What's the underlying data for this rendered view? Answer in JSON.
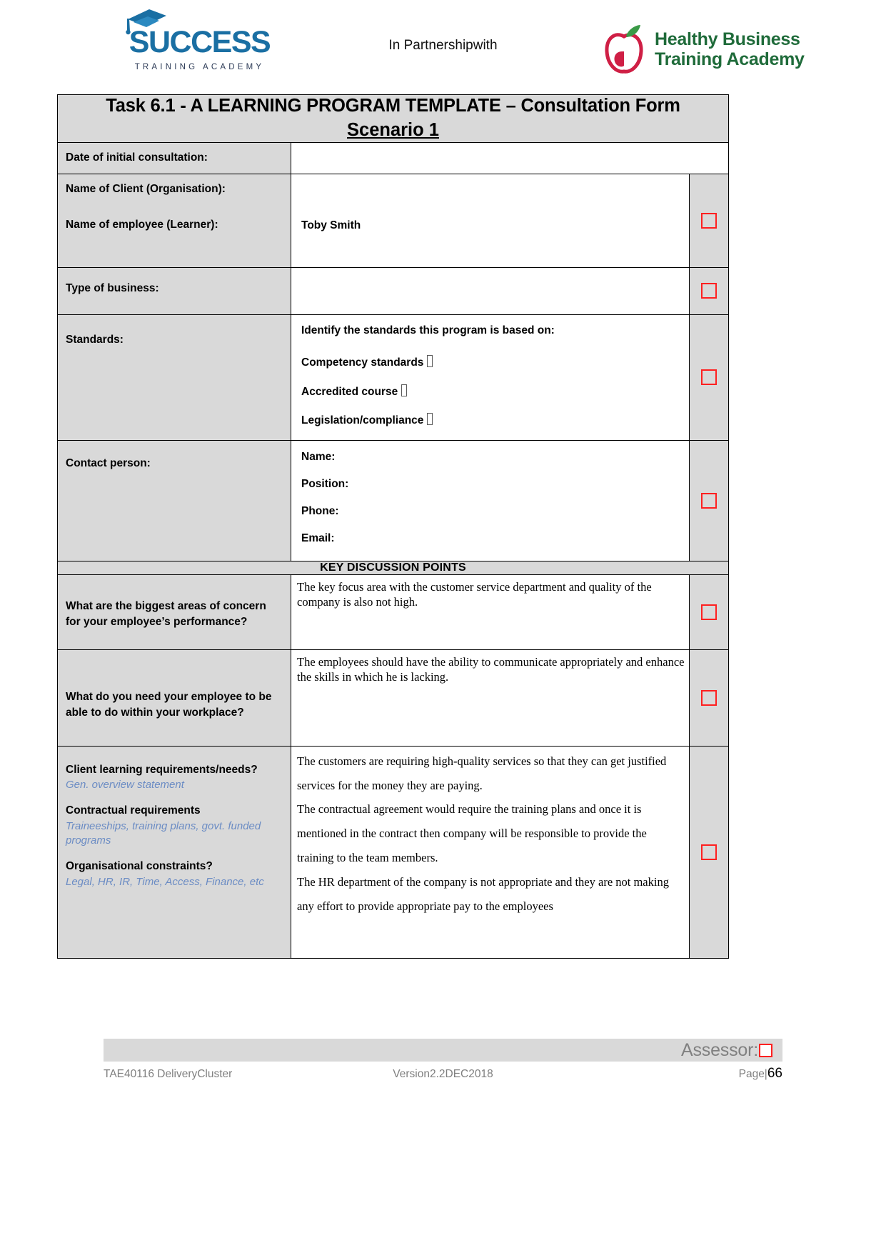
{
  "header": {
    "left_logo": {
      "word": "SUCCESS",
      "subtitle": "TRAINING ACADEMY",
      "icon": "graduation-cap-icon"
    },
    "partnership_text": "In Partnershipwith",
    "right_logo": {
      "line1": "Healthy Business",
      "line2": "Training Academy",
      "icon": "apple-icon"
    }
  },
  "form": {
    "title_line1": "Task 6.1 - A LEARNING PROGRAM TEMPLATE – Consultation Form",
    "title_line2": "Scenario 1",
    "rows": {
      "date_label": "Date of initial consultation:",
      "date_value": "",
      "client_label": "Name of Client (Organisation):",
      "learner_label": "Name of employee (Learner):",
      "learner_value": "Toby Smith",
      "business_label": "Type of business:",
      "business_value": "",
      "standards_label": "Standards:",
      "standards_prompt": "Identify the standards this program is based on:",
      "standards_option1": "Competency standards",
      "standards_option2": "Accredited course",
      "standards_option3": "Legislation/compliance",
      "contact_label": "Contact person:",
      "contact_name": "Name:",
      "contact_position": "Position:",
      "contact_phone": "Phone:",
      "contact_email": "Email:",
      "section_heading": "KEY DISCUSSION POINTS",
      "q1_label": "What are the biggest areas of concern for your employee’s performance?",
      "q1_answer": "The key focus area with the customer service department and quality of the company is also not high.",
      "q2_label": "What do you need your employee to be able to do within your workplace?",
      "q2_answer": "The employees should have the ability to communicate appropriately and enhance the skills in which he is lacking.",
      "q3_label_a": "Client learning requirements/needs?",
      "q3_hint_a": "Gen. overview statement",
      "q3_label_b": "Contractual requirements",
      "q3_hint_b": "Traineeships, training plans, govt. funded programs",
      "q3_label_c": "Organisational constraints?",
      "q3_hint_c": "Legal, HR, IR, Time, Access, Finance, etc",
      "q3_answer_p1": "The customers are requiring high-quality services so that they can get justified services for the money they are paying.",
      "q3_answer_p2": "The contractual agreement would require the training plans and once it is mentioned in the contract then company will be responsible to provide the training to the team members.",
      "q3_answer_p3": "The HR department of the company is not appropriate and they are not making any effort to provide appropriate pay to the employees"
    }
  },
  "footer": {
    "assessor_label": "Assessor:",
    "left": "TAE40116 DeliveryCluster",
    "center": "Version2.2DEC2018",
    "page_label": "Page|",
    "page_number": "66"
  },
  "colors": {
    "cell_grey": "#d9d9d9",
    "checkbox_red": "#ff2020",
    "hint_blue": "#6b8cc4",
    "success_blue": "#1a6fa3",
    "hbta_green": "#1f6b3a",
    "footer_grey": "#7f7f7f"
  }
}
